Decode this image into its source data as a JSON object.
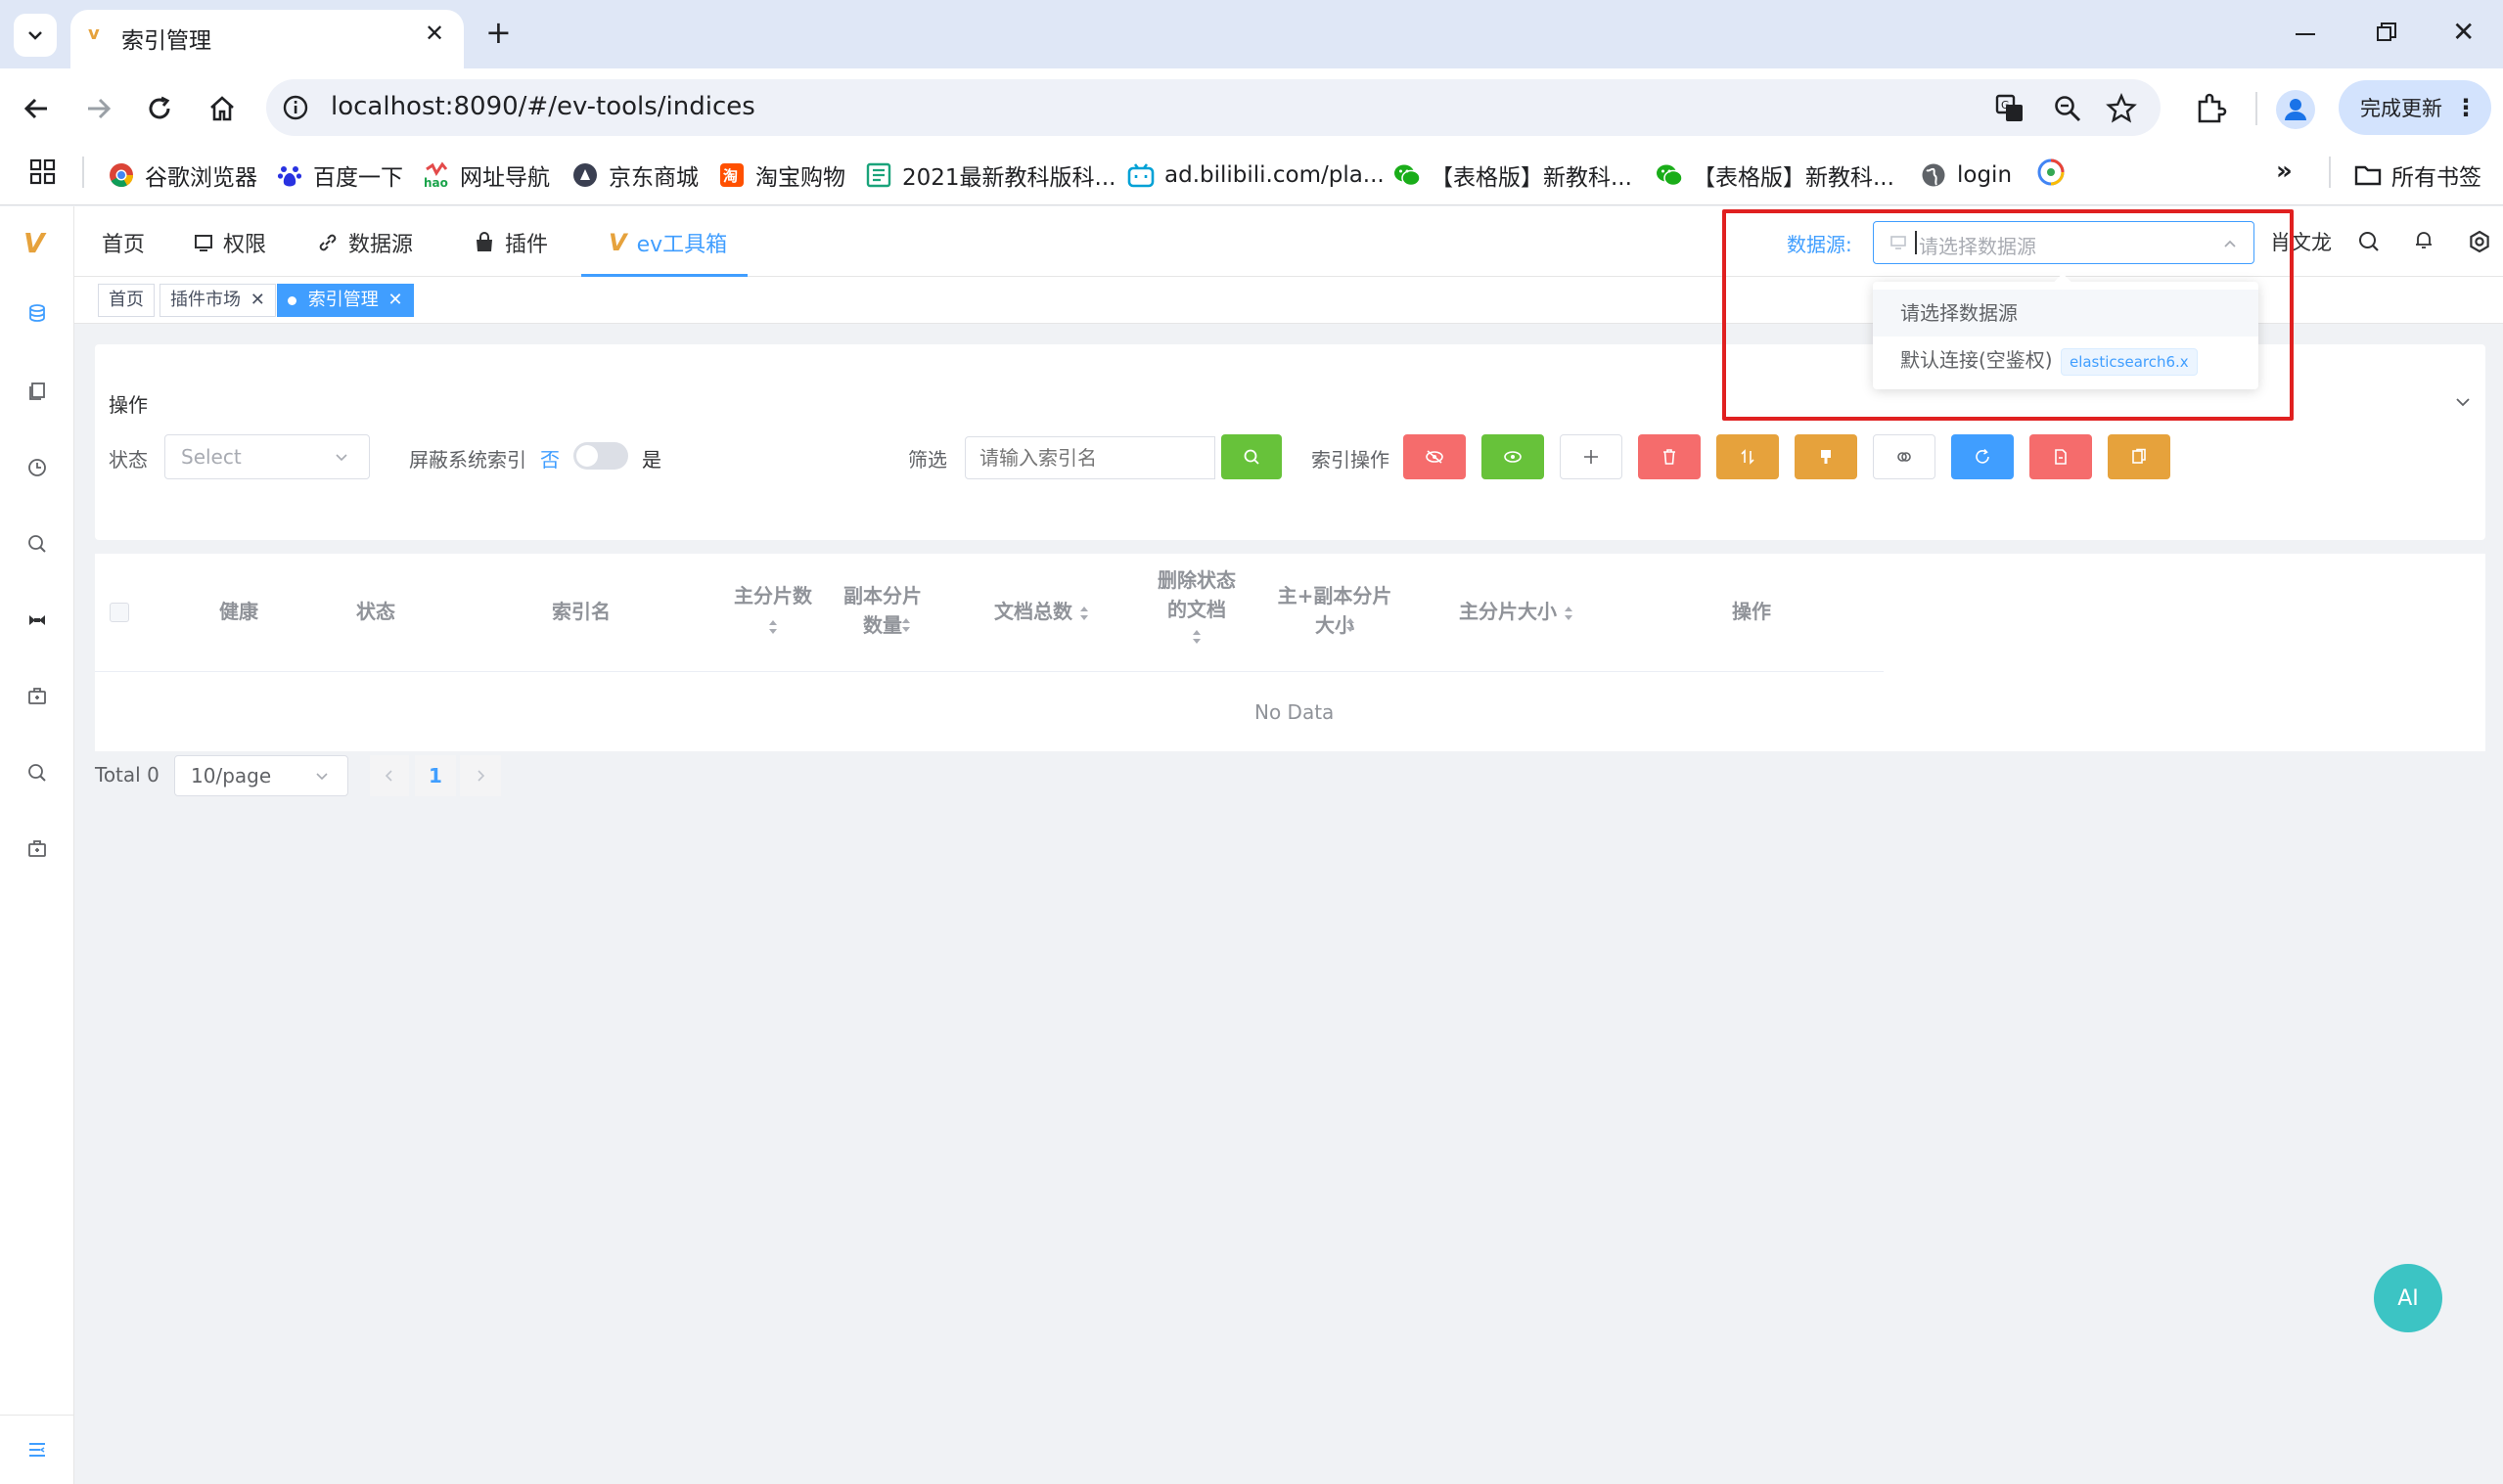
{
  "browser": {
    "tab_title": "索引管理",
    "url_host": "localhost",
    "url_rest": ":8090/#/ev-tools/indices",
    "update_button": "完成更新",
    "bookmarks": [
      {
        "label": "谷歌浏览器",
        "icon": "chrome-icon"
      },
      {
        "label": "百度一下",
        "icon": "baidu-icon"
      },
      {
        "label": "网址导航",
        "icon": "hao-icon"
      },
      {
        "label": "京东商城",
        "icon": "jd-icon"
      },
      {
        "label": "淘宝购物",
        "icon": "taobao-icon"
      },
      {
        "label": "2021最新教科版科...",
        "icon": "doc-icon"
      },
      {
        "label": "ad.bilibili.com/pla...",
        "icon": "bilibili-icon"
      },
      {
        "label": "【表格版】新教科...",
        "icon": "wechat-icon"
      },
      {
        "label": "【表格版】新教科...",
        "icon": "wechat-icon"
      },
      {
        "label": "login",
        "icon": "globe-icon"
      }
    ],
    "all_bookmarks": "所有书签"
  },
  "header": {
    "nav": [
      {
        "label": "首页"
      },
      {
        "label": "权限"
      },
      {
        "label": "数据源"
      },
      {
        "label": "插件"
      },
      {
        "label": "ev工具箱"
      }
    ],
    "datasource_label": "数据源:",
    "datasource_placeholder": "请选择数据源",
    "username": "肖文龙"
  },
  "tags": [
    {
      "label": "首页"
    },
    {
      "label": "插件市场"
    },
    {
      "label": "索引管理"
    }
  ],
  "dropdown": {
    "items": [
      {
        "label": "请选择数据源"
      },
      {
        "label": "默认连接(空鉴权)",
        "badge": "elasticsearch6.x"
      }
    ]
  },
  "operations": {
    "title": "操作",
    "status_label": "状态",
    "status_placeholder": "Select",
    "hide_system_label": "屏蔽系统索引",
    "no": "否",
    "yes": "是",
    "filter_label": "筛选",
    "filter_placeholder": "请输入索引名",
    "index_ops_label": "索引操作"
  },
  "table": {
    "columns": [
      "健康",
      "状态",
      "索引名",
      "主分片数",
      "副本分片数量",
      "文档总数",
      "删除状态的文档",
      "主+副本分片大小",
      "主分片大小",
      "操作"
    ],
    "empty_text": "No Data"
  },
  "pagination": {
    "total": "Total 0",
    "page_size": "10/page",
    "current_page": "1"
  },
  "ai_button": "AI",
  "colors": {
    "primary": "#409eff",
    "success": "#67c23a",
    "danger": "#f56c6c",
    "warning": "#e6a23c",
    "highlight_box": "#e02020",
    "ai": "#3cc4c4"
  }
}
